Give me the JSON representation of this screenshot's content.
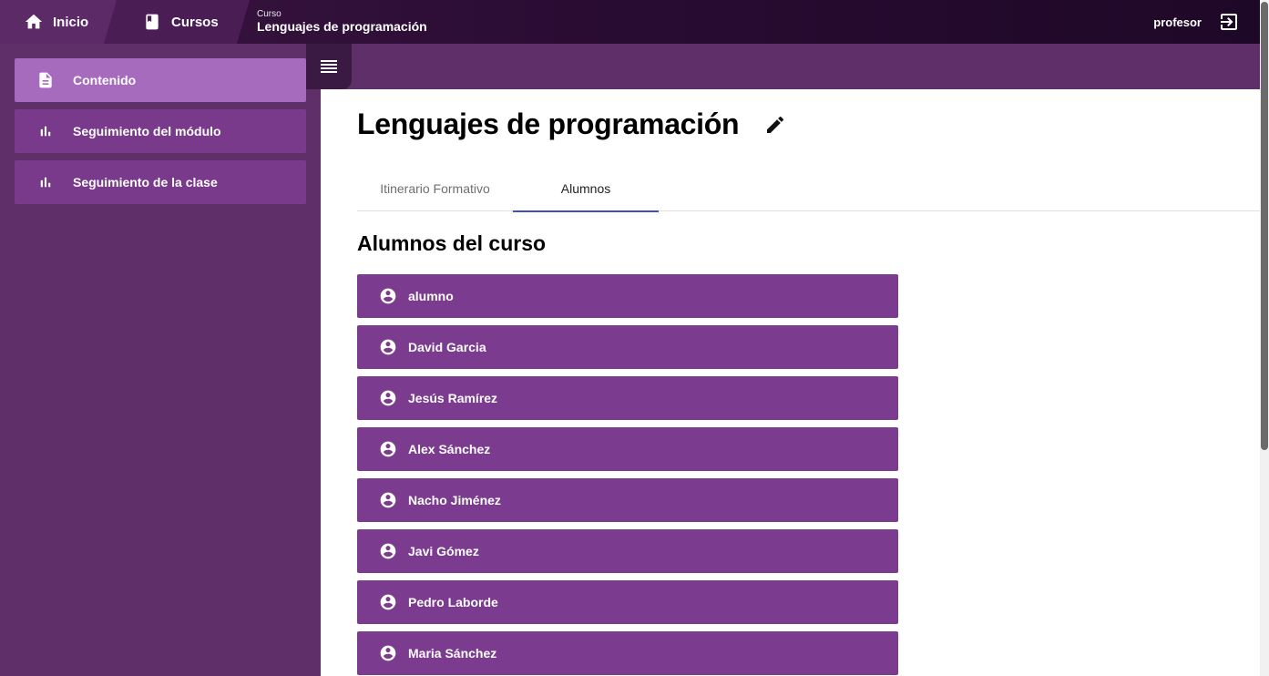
{
  "topbar": {
    "home_label": "Inicio",
    "courses_label": "Cursos",
    "current_small": "Curso",
    "current_title": "Lenguajes de programación",
    "username": "profesor"
  },
  "sidebar": {
    "items": [
      {
        "label": "Contenido",
        "icon": "document-icon"
      },
      {
        "label": "Seguimiento del módulo",
        "icon": "bar-chart-icon"
      },
      {
        "label": "Seguimiento de la clase",
        "icon": "bar-chart-icon"
      }
    ]
  },
  "main": {
    "title": "Lenguajes de programación",
    "tabs": [
      {
        "label": "Itinerario Formativo"
      },
      {
        "label": "Alumnos"
      }
    ],
    "section_title": "Alumnos del curso",
    "students": [
      "alumno",
      "David Garcia",
      "Jesús Ramírez",
      "Alex Sánchez",
      "Nacho Jiménez",
      "Javi Gómez",
      "Pedro Laborde",
      "Maria Sánchez"
    ]
  },
  "colors": {
    "brand_purple": "#5e2f68",
    "item_purple": "#7b3b8f",
    "active_item": "#a66bbd",
    "tab_indicator": "#3f51b5"
  }
}
